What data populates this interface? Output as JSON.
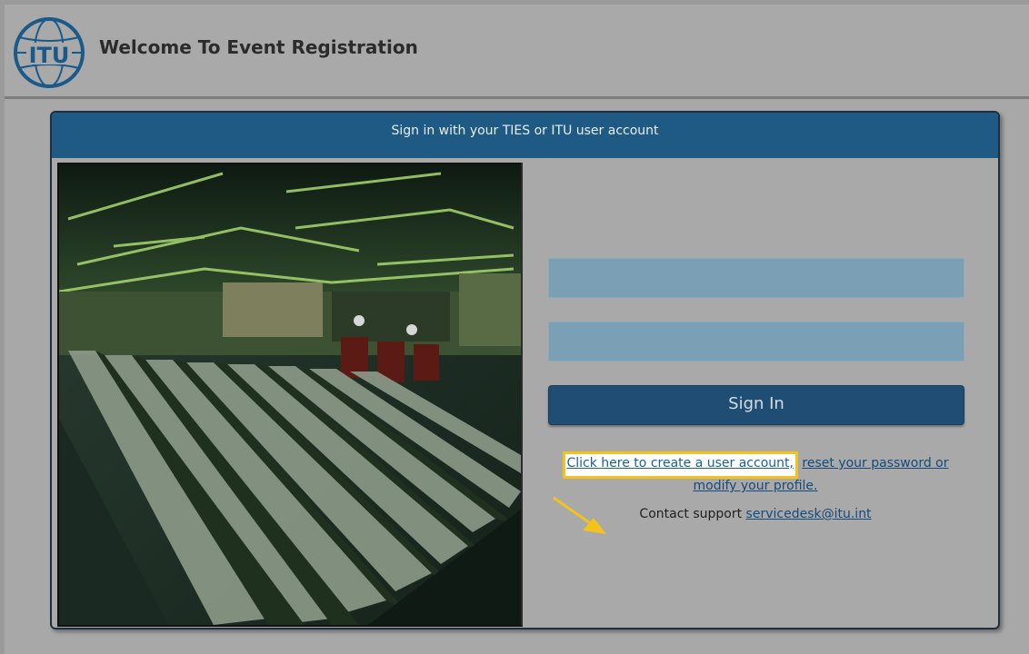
{
  "header": {
    "title": "Welcome To Event Registration",
    "logo_text": "ITU"
  },
  "panel": {
    "heading": "Sign in with your TIES or ITU user account"
  },
  "form": {
    "username_value": "",
    "password_value": "",
    "signin_label": "Sign In"
  },
  "links": {
    "create_account": "Click here to create a user account,",
    "reset_password": "reset your password or modify your profile."
  },
  "contact": {
    "label": "Contact support",
    "email": "servicedesk@itu.int"
  },
  "colors": {
    "header_bar": "#1f5a84",
    "button": "#1f4d74",
    "highlight_border": "#f3c31c",
    "arrow": "#f3c31c",
    "link": "#164a7a"
  }
}
